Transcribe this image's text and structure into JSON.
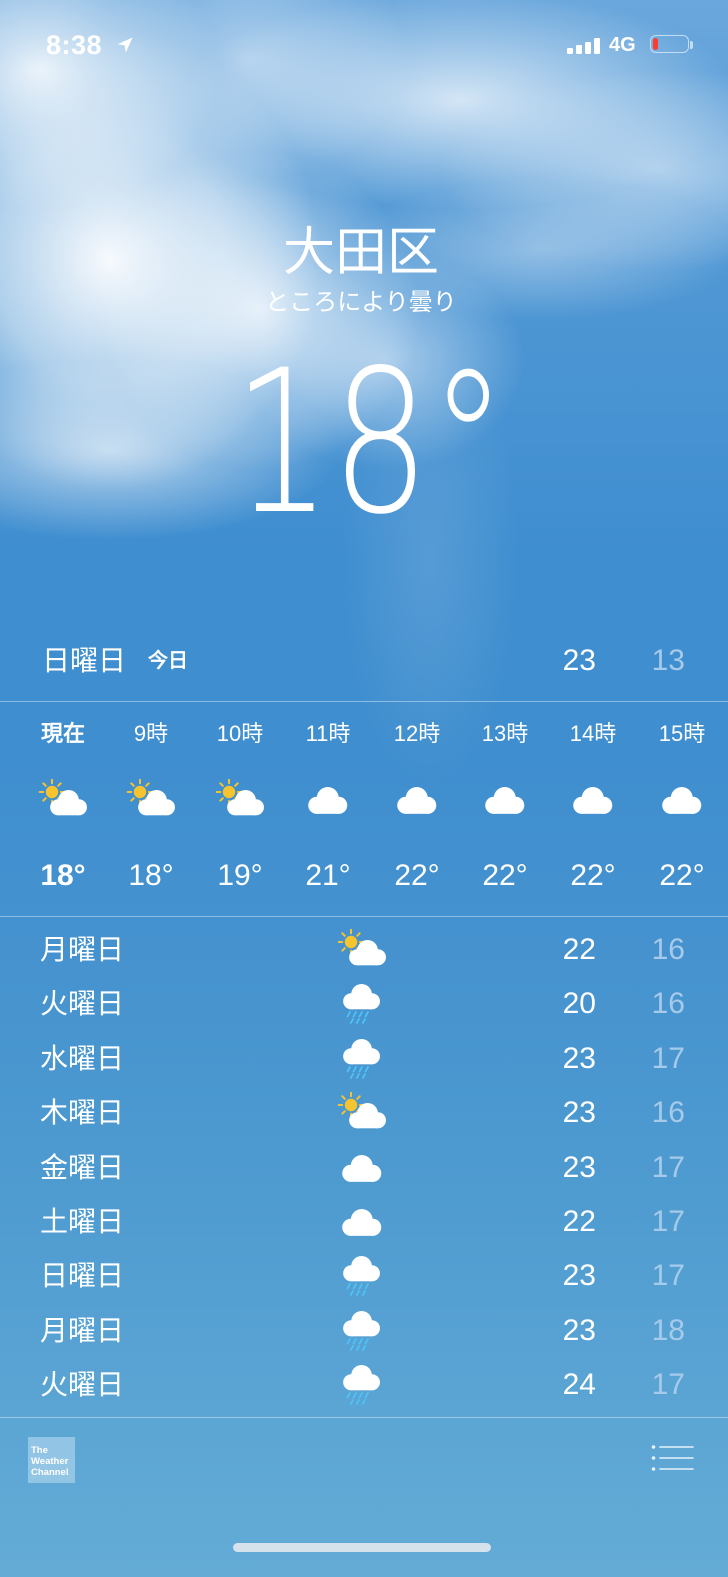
{
  "status_bar": {
    "time": "8:38",
    "network": "4G",
    "signal_bars": 4,
    "battery_level": 0.15,
    "location_icon": "location-arrow-icon",
    "signal_icon": "cellular-signal-icon",
    "battery_icon": "battery-icon"
  },
  "location": {
    "name": "大田区",
    "condition": "ところにより曇り"
  },
  "current": {
    "temperature": "18°"
  },
  "today": {
    "day": "日曜日",
    "label": "今日",
    "high": "23",
    "low": "13"
  },
  "hourly": [
    {
      "time": "現在",
      "icon": "partly-cloudy-day",
      "temp": "18°"
    },
    {
      "time": "9時",
      "icon": "partly-cloudy-day",
      "temp": "18°"
    },
    {
      "time": "10時",
      "icon": "partly-cloudy-day",
      "temp": "19°"
    },
    {
      "time": "11時",
      "icon": "cloud",
      "temp": "21°"
    },
    {
      "time": "12時",
      "icon": "cloud",
      "temp": "22°"
    },
    {
      "time": "13時",
      "icon": "cloud",
      "temp": "22°"
    },
    {
      "time": "14時",
      "icon": "cloud",
      "temp": "22°"
    },
    {
      "time": "15時",
      "icon": "cloud",
      "temp": "22°"
    }
  ],
  "daily": [
    {
      "day": "月曜日",
      "icon": "partly-cloudy-day",
      "high": "22",
      "low": "16"
    },
    {
      "day": "火曜日",
      "icon": "rain",
      "high": "20",
      "low": "16"
    },
    {
      "day": "水曜日",
      "icon": "rain",
      "high": "23",
      "low": "17"
    },
    {
      "day": "木曜日",
      "icon": "partly-cloudy-day",
      "high": "23",
      "low": "16"
    },
    {
      "day": "金曜日",
      "icon": "cloud",
      "high": "23",
      "low": "17"
    },
    {
      "day": "土曜日",
      "icon": "cloud",
      "high": "22",
      "low": "17"
    },
    {
      "day": "日曜日",
      "icon": "rain",
      "high": "23",
      "low": "17"
    },
    {
      "day": "月曜日",
      "icon": "rain",
      "high": "23",
      "low": "18"
    },
    {
      "day": "火曜日",
      "icon": "rain",
      "high": "24",
      "low": "17"
    }
  ],
  "footer": {
    "logo": [
      "The",
      "Weather",
      "Channel"
    ],
    "logo_icon": "the-weather-channel-logo",
    "list_icon": "list-icon"
  },
  "colors": {
    "text": "#ffffff",
    "low_temp": "#a6cbea",
    "sun": "#f8c42e",
    "rain": "#4fc3f7",
    "cloud": "#ffffff",
    "battery_low": "#ff3b30"
  }
}
